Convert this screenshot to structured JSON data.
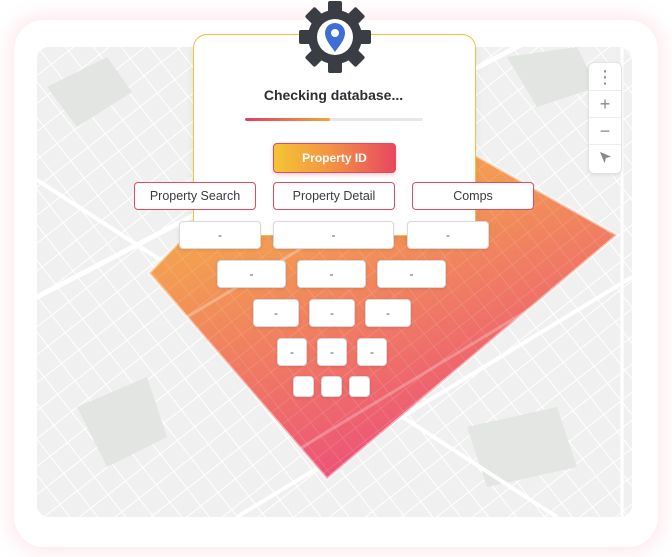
{
  "status_text": "Checking database...",
  "progress_fraction": 0.48,
  "property_id_label": "Property ID",
  "tabs": [
    "Property Search",
    "Property Detail",
    "Comps"
  ],
  "cell_value": "-",
  "rows": [
    [
      "-",
      "-",
      "-"
    ],
    [
      "-",
      "-",
      "-"
    ],
    [
      "-",
      "-",
      "-"
    ],
    [
      "-",
      "-",
      "-"
    ],
    [
      "",
      "",
      ""
    ]
  ],
  "map_controls": [
    "more-options",
    "zoom-in",
    "zoom-out",
    "locate"
  ],
  "icons": {
    "gear": "gear-icon",
    "pin": "location-pin-icon"
  },
  "colors": {
    "accent_red": "#e24a5e",
    "accent_orange": "#f39543",
    "accent_yellow": "#f4c434",
    "pin_blue": "#3d6fd6",
    "gear_dark": "#3a3d44"
  }
}
